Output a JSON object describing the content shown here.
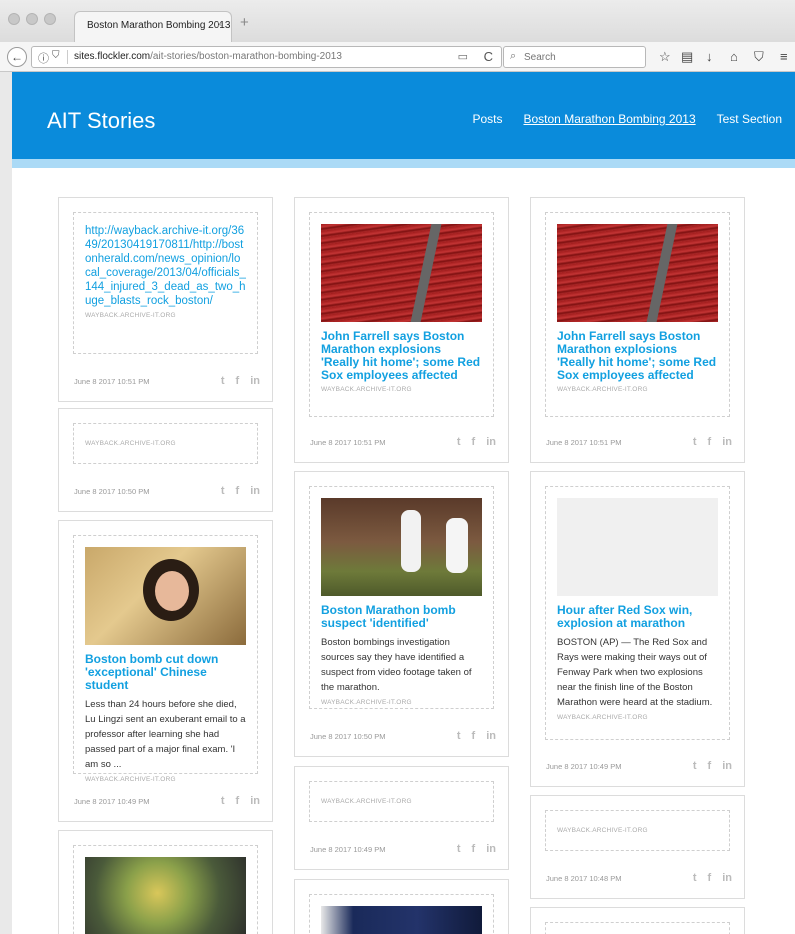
{
  "browser": {
    "tab_title": "Boston Marathon Bombing 2013",
    "tab_close": "×",
    "new_tab": "+",
    "url_domain": "sites.flockler.com",
    "url_path": "/ait-stories/boston-marathon-bombing-2013",
    "search_placeholder": "Search",
    "icons": {
      "back": "←",
      "info": "ⓘ",
      "shield": "⛉",
      "reader": "▭",
      "reload": "C",
      "search": "⌕",
      "star": "☆",
      "bookmarks": "▤",
      "download": "↓",
      "home": "⌂",
      "pocket": "⛉",
      "menu": "≡"
    }
  },
  "site": {
    "title": "AIT Stories",
    "nav": [
      "Posts",
      "Boston Marathon Bombing 2013",
      "Test Section"
    ],
    "header_color": "#0a8bdb",
    "accent_color": "#12a0e0"
  },
  "share": {
    "twitter": "t",
    "facebook": "f",
    "linkedin": "in"
  },
  "cards": [
    {
      "link": "http://wayback.archive-it.org/3649/20130419170811/http://bostonherald.com/news_opinion/local_coverage/2013/04/officials_144_injured_3_dead_as_two_huge_blasts_rock_boston/",
      "source": "WAYBACK.ARCHIVE-IT.ORG",
      "date": "June 8 2017 10:51 PM"
    },
    {
      "source": "WAYBACK.ARCHIVE-IT.ORG",
      "date": "June 8 2017 10:50 PM"
    },
    {
      "title": "Boston bomb cut down 'exceptional' Chinese student",
      "desc": "Less than 24 hours before she died, Lu Lingzi sent an exuberant email to a pro­fessor after learning she had passed part of a major final exam. 'I am so ...",
      "source": "WAYBACK.ARCHIVE-IT.ORG",
      "date": "June 8 2017 10:49 PM"
    },
    {
      "title": "John Farrell says Boston Marathon explosions 'Really hit home'; some Red Sox employees affected",
      "source": "WAYBACK.ARCHIVE-IT.ORG",
      "date": "June 8 2017 10:51 PM"
    },
    {
      "title": "Boston Marathon bomb suspect 'identified'",
      "desc": "Boston bombings investigation sources say they have identified a suspect from video footage taken of the marathon.",
      "source": "WAYBACK.ARCHIVE-IT.ORG",
      "date": "June 8 2017 10:50 PM"
    },
    {
      "source": "WAYBACK.ARCHIVE-IT.ORG",
      "date": "June 8 2017 10:49 PM"
    },
    {
      "title": "John Farrell says Boston Marathon explosions 'Really hit home'; some Red Sox employees affected",
      "source": "WAYBACK.ARCHIVE-IT.ORG",
      "date": "June 8 2017 10:51 PM"
    },
    {
      "title": "Hour after Red Sox win, explosion at marathon",
      "desc": "BOSTON (AP) — The Red Sox and Rays were making their ways out of Fenway Park when two explosions near the finish line of the Boston Marathon were heard at the stadium.",
      "source": "WAYBACK.ARCHIVE-IT.ORG",
      "date": "June 8 2017 10:49 PM"
    },
    {
      "source": "WAYBACK.ARCHIVE-IT.ORG",
      "date": "June 8 2017 10:48 PM"
    }
  ]
}
